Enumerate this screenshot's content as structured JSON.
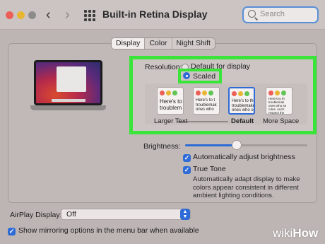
{
  "window": {
    "title": "Built-in Retina Display",
    "search_placeholder": "Search",
    "nav_back_icon": "chevron-left-icon",
    "nav_forward_icon": "chevron-right-icon",
    "grid_icon": "grid-icon"
  },
  "tabs": [
    {
      "label": "Display",
      "selected": true
    },
    {
      "label": "Color",
      "selected": false
    },
    {
      "label": "Night Shift",
      "selected": false
    }
  ],
  "resolution": {
    "label": "Resolution:",
    "options": [
      {
        "label": "Default for display",
        "selected": false
      },
      {
        "label": "Scaled",
        "selected": true
      }
    ]
  },
  "scale_options": [
    {
      "label": "Larger Text",
      "preview": "Here's to t\ntroublem",
      "selected": false
    },
    {
      "label": "",
      "preview": "Here's to t\ntroublemak\nones who",
      "selected": false
    },
    {
      "label": "Default",
      "preview": "Here's to the\ntroublemakers\nones who see\nrules. And the",
      "selected": true
    },
    {
      "label": "More Space",
      "preview": "Here's to th\ntroublemak\nones who se\nrules. And t\nrespect the",
      "selected": false
    }
  ],
  "brightness": {
    "label": "Brightness:",
    "level": 0.42
  },
  "auto_brightness": {
    "label": "Automatically adjust brightness",
    "checked": true
  },
  "true_tone": {
    "label": "True Tone",
    "checked": true,
    "description": "Automatically adapt display to make colors appear consistent in different ambient lighting conditions."
  },
  "airplay": {
    "label": "AirPlay Display:",
    "value": "Off"
  },
  "mirroring": {
    "label": "Show mirroring options in the menu bar when available",
    "checked": true
  },
  "watermark": {
    "part1": "wiki",
    "part2": "How"
  },
  "colors": {
    "accent": "#2f6bd6",
    "highlight": "#3ae53a",
    "traffic_red": "#ec5f57",
    "traffic_yellow": "#e9b632"
  }
}
